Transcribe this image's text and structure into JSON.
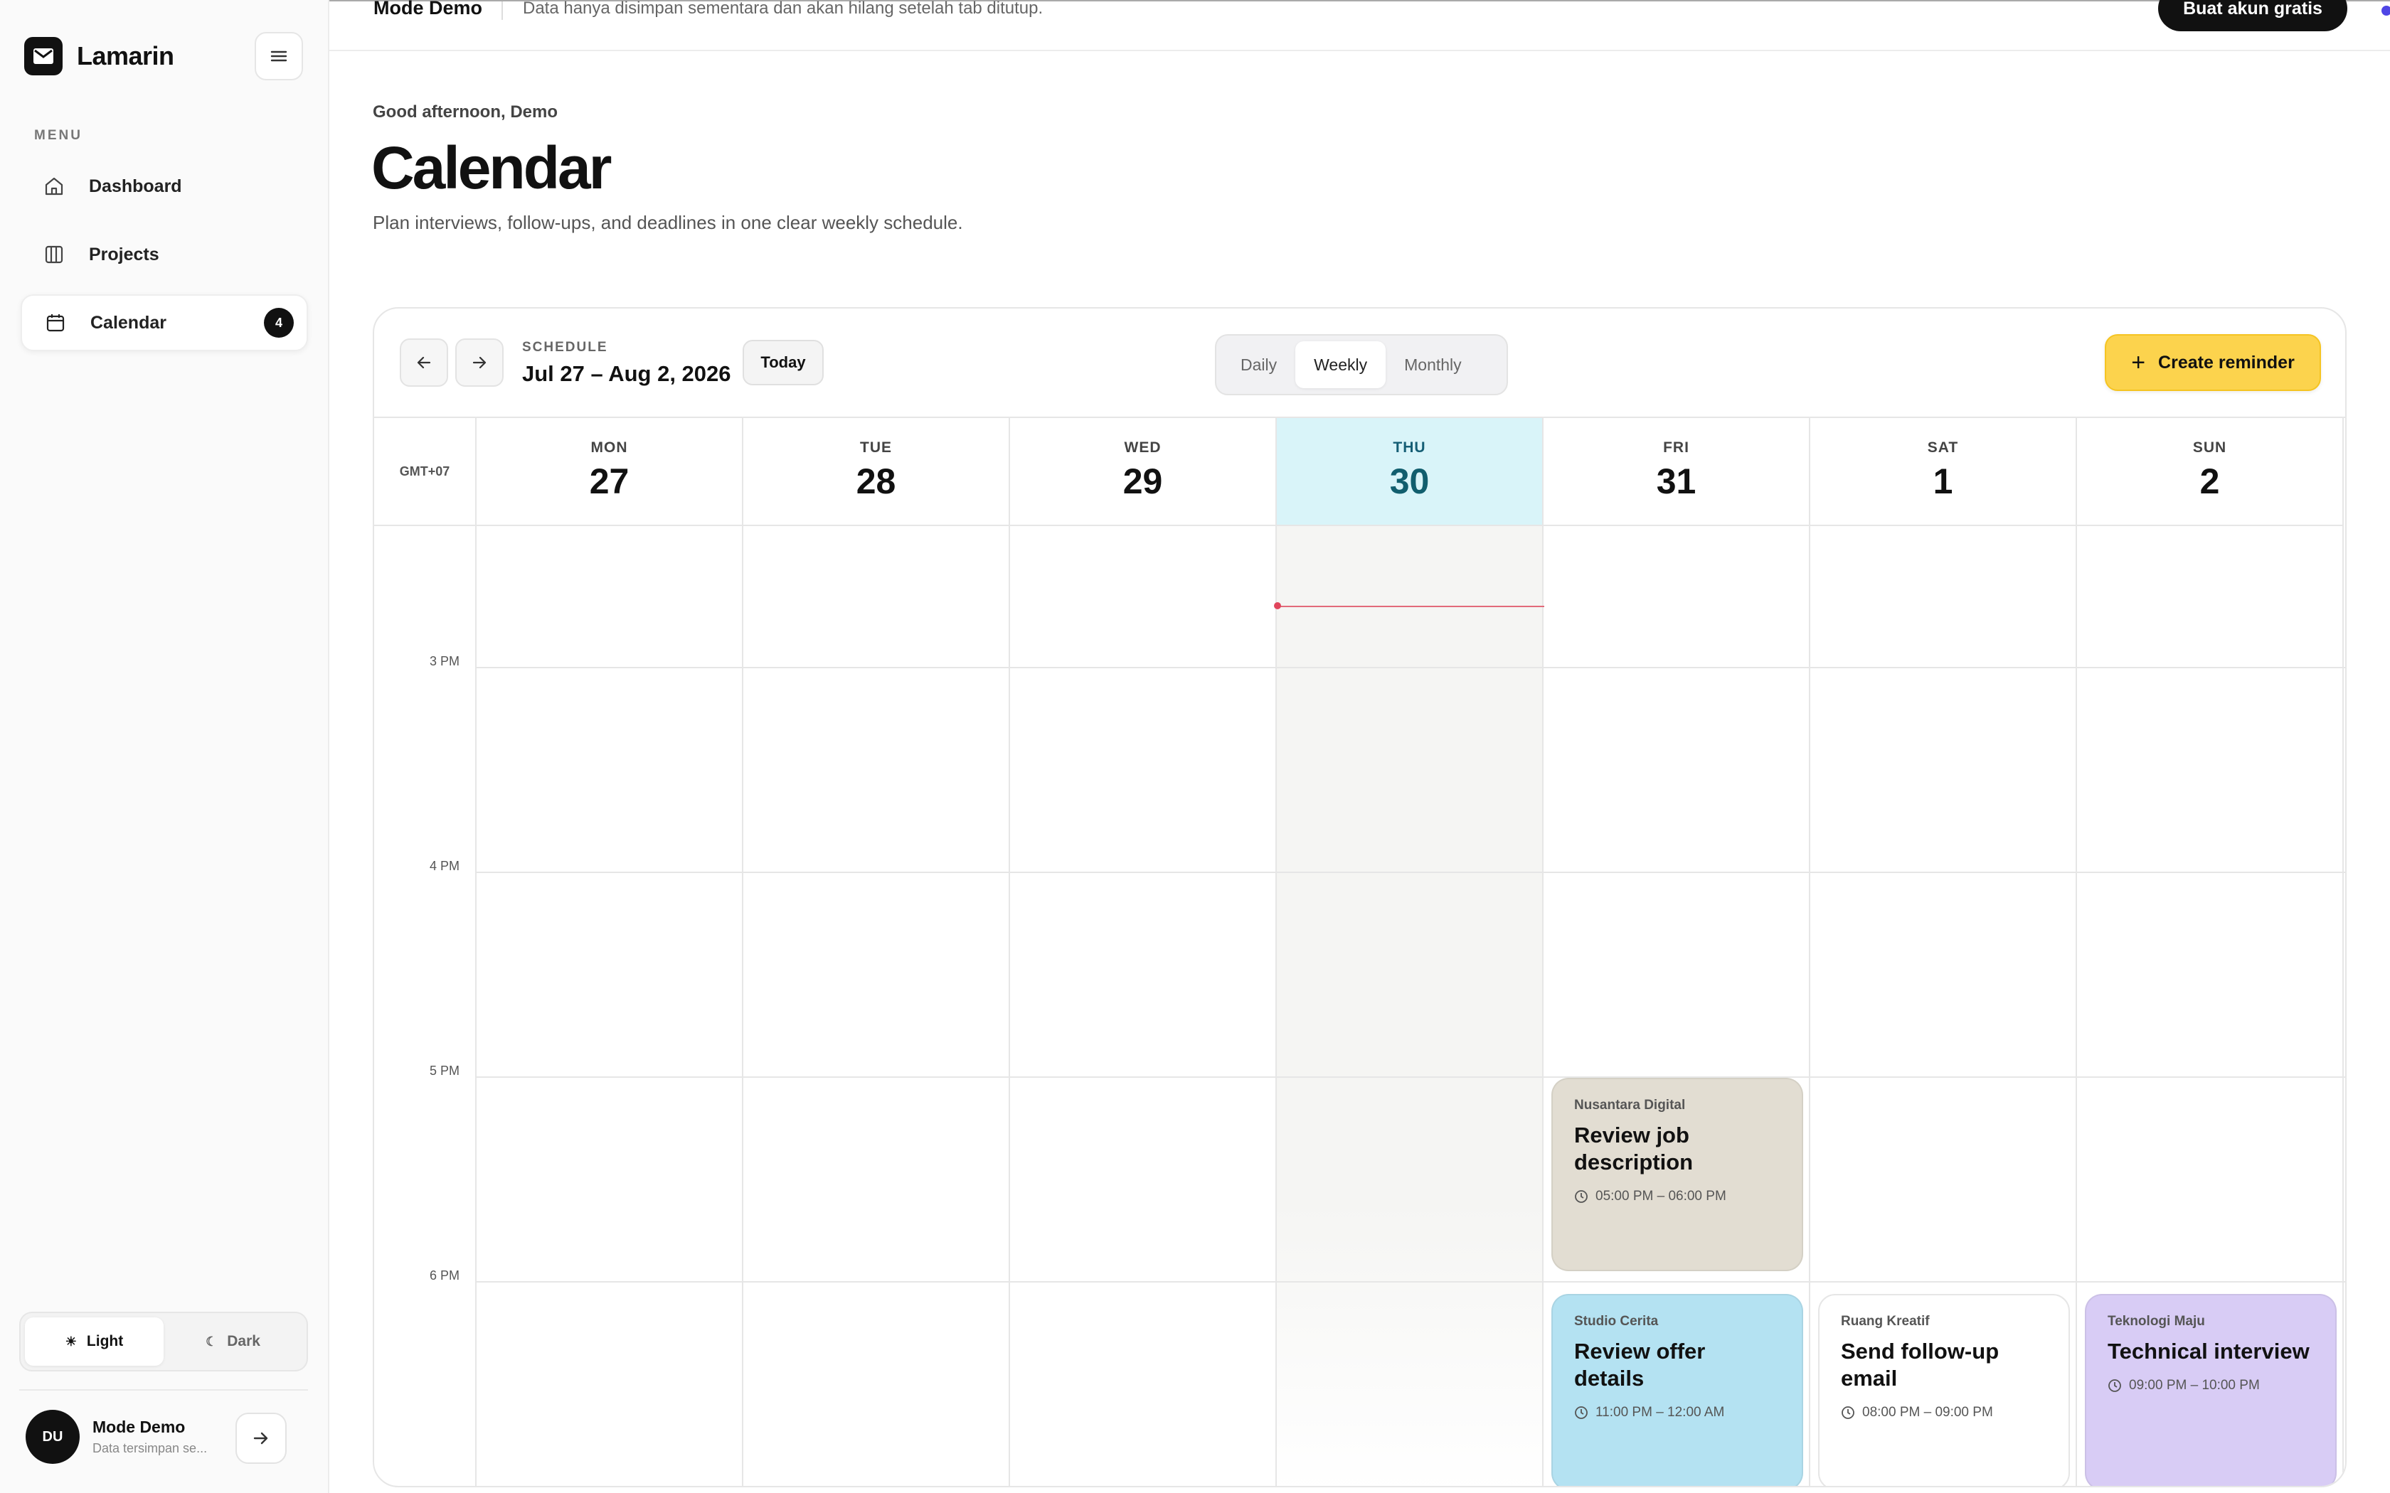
{
  "app": {
    "name": "Lamarin"
  },
  "sidebar": {
    "menu_heading": "MENU",
    "items": [
      {
        "label": "Dashboard",
        "icon": "home-icon"
      },
      {
        "label": "Projects",
        "icon": "columns-icon"
      },
      {
        "label": "Calendar",
        "icon": "calendar-icon",
        "badge": "4",
        "active": true
      }
    ],
    "theme": {
      "light": "Light",
      "dark": "Dark",
      "selected": "Light"
    },
    "user": {
      "initials": "DU",
      "name": "Mode Demo",
      "subtitle": "Data tersimpan se..."
    }
  },
  "topbar": {
    "mode": "Mode Demo",
    "note": "Data hanya disimpan sementara dan akan hilang setelah tab ditutup.",
    "signup_label": "Buat akun gratis"
  },
  "page": {
    "greeting": "Good afternoon, Demo",
    "title": "Calendar",
    "description": "Plan interviews, follow-ups, and deadlines in one clear weekly schedule."
  },
  "calendar": {
    "schedule_label": "SCHEDULE",
    "range": "Jul 27 – Aug 2, 2026",
    "today_label": "Today",
    "views": [
      "Daily",
      "Weekly",
      "Monthly"
    ],
    "selected_view": "Weekly",
    "create_label": "Create reminder",
    "timezone": "GMT+07",
    "days": [
      {
        "name": "MON",
        "num": "27"
      },
      {
        "name": "TUE",
        "num": "28"
      },
      {
        "name": "WED",
        "num": "29"
      },
      {
        "name": "THU",
        "num": "30",
        "today": true
      },
      {
        "name": "FRI",
        "num": "31"
      },
      {
        "name": "SAT",
        "num": "1"
      },
      {
        "name": "SUN",
        "num": "2"
      }
    ],
    "hours": [
      "3 PM",
      "4 PM",
      "5 PM",
      "6 PM"
    ],
    "events": [
      {
        "company": "Nusantara Digital",
        "title": "Review job description",
        "time": "05:00 PM – 06:00 PM",
        "color": "#e2ddd2"
      },
      {
        "company": "Studio Cerita",
        "title": "Review offer details",
        "time": "11:00 PM – 12:00 AM",
        "color": "#b4e2f2"
      },
      {
        "company": "Ruang Kreatif",
        "title": "Send follow-up email",
        "time": "08:00 PM – 09:00 PM",
        "color": "#ffffff"
      },
      {
        "company": "Teknologi Maju",
        "title": "Technical interview",
        "time": "09:00 PM – 10:00 PM",
        "color": "#d8ccf5"
      }
    ]
  }
}
